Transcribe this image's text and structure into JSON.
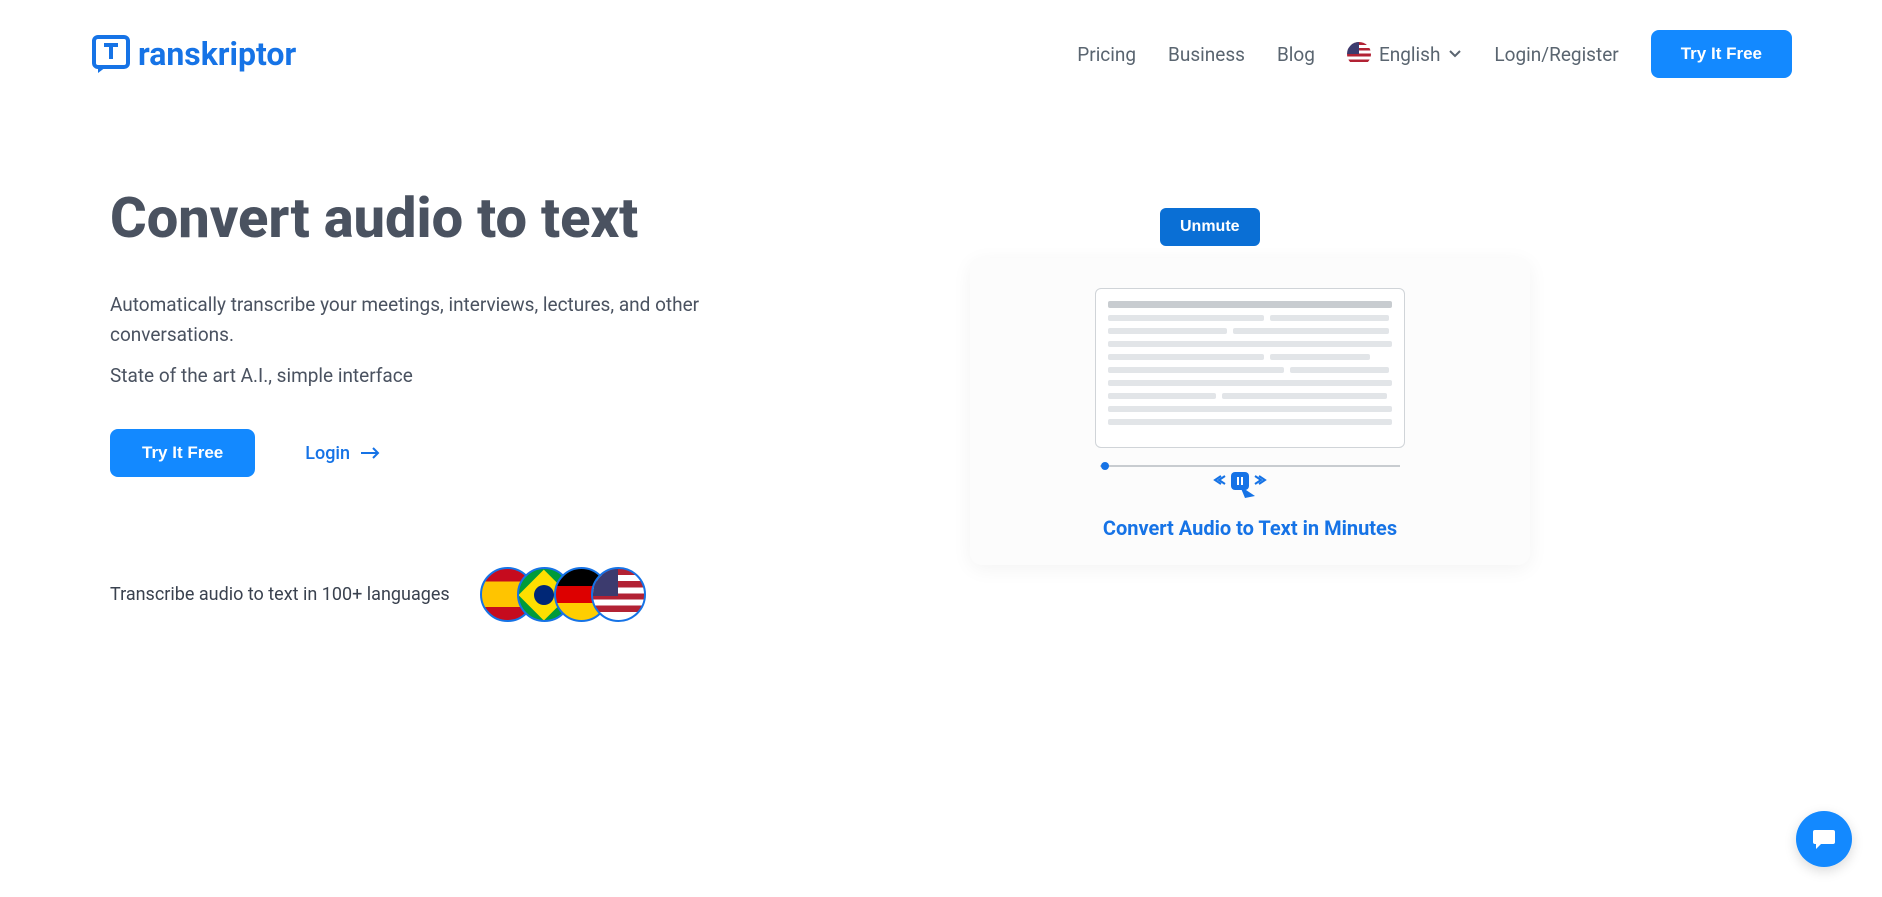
{
  "logo": {
    "text": "ranskriptor"
  },
  "nav": {
    "pricing": "Pricing",
    "business": "Business",
    "blog": "Blog",
    "language": "English",
    "login_register": "Login/Register",
    "try_free": "Try It Free"
  },
  "hero": {
    "title": "Convert audio to text",
    "description": "Automatically transcribe your meetings, interviews, lectures, and other conversations.",
    "subtext": "State of the art A.I., simple interface",
    "cta_primary": "Try It Free",
    "cta_login": "Login"
  },
  "lang_feature": {
    "text": "Transcribe audio to text in 100+ languages"
  },
  "video": {
    "unmute": "Unmute",
    "title": "Convert Audio to Text in Minutes"
  }
}
